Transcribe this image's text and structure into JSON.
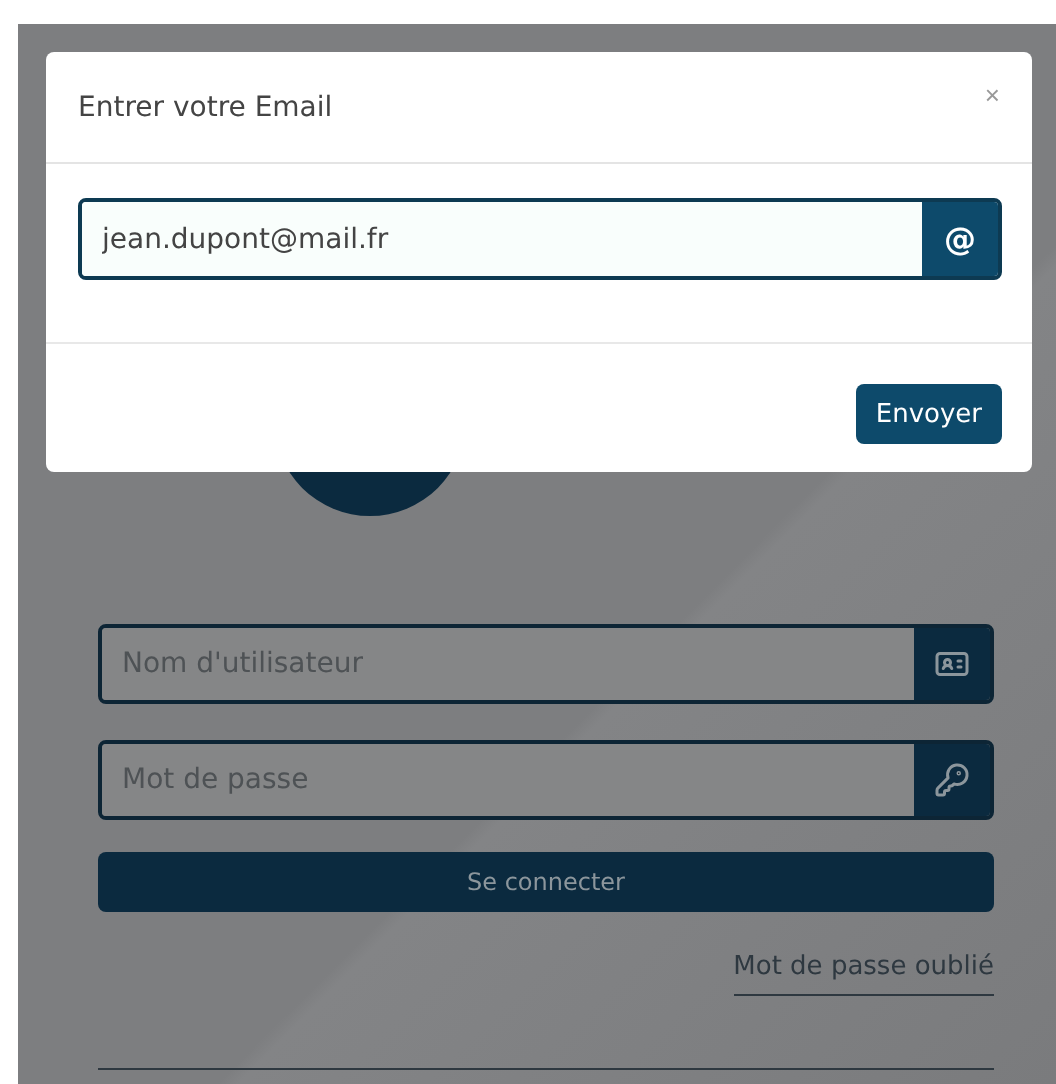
{
  "modal": {
    "title": "Entrer votre Email",
    "close": "×",
    "email": {
      "value": "jean.dupont@mail.fr",
      "addon": "@"
    },
    "submit": "Envoyer"
  },
  "login": {
    "username": {
      "placeholder": "Nom d'utilisateur"
    },
    "password": {
      "placeholder": "Mot de passe"
    },
    "submit": "Se connecter",
    "forgot": "Mot de passe oublié"
  }
}
